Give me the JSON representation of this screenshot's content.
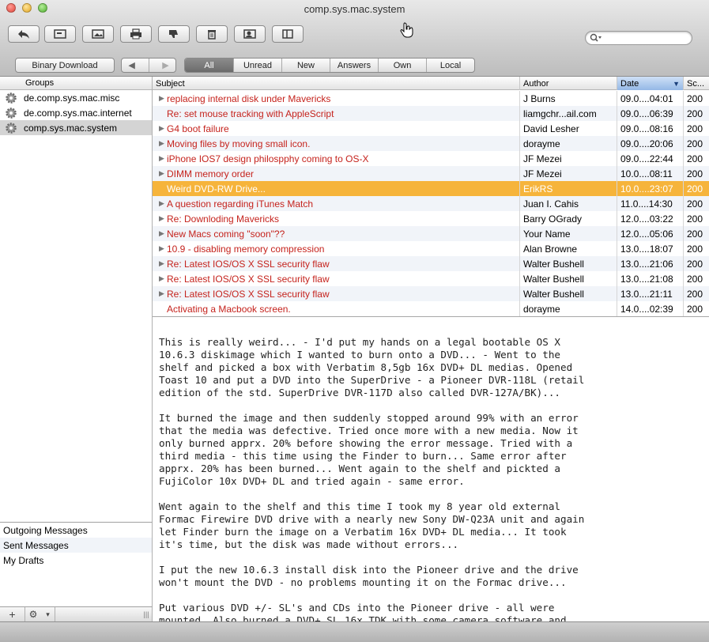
{
  "window": {
    "title": "comp.sys.mac.system"
  },
  "toolbar": {
    "buttons": [
      {
        "name": "reply-icon"
      },
      {
        "name": "compose-icon"
      },
      {
        "name": "image-icon"
      },
      {
        "name": "print-icon"
      },
      {
        "name": "thumbs-down-icon"
      },
      {
        "name": "trash-icon"
      },
      {
        "name": "people-search-icon"
      },
      {
        "name": "panel-icon"
      }
    ],
    "search_placeholder": ""
  },
  "filter_bar": {
    "binary_download": "Binary Download",
    "back": "◀",
    "forward": "▶",
    "tabs": [
      "All",
      "Unread",
      "New",
      "Answers",
      "Own",
      "Local"
    ],
    "active_tab": "All"
  },
  "groups": {
    "header": "Groups",
    "items": [
      {
        "label": "de.comp.sys.mac.misc"
      },
      {
        "label": "de.comp.sys.mac.internet"
      },
      {
        "label": "comp.sys.mac.system",
        "selected": true
      }
    ]
  },
  "mailboxes": {
    "items": [
      "Outgoing Messages",
      "Sent Messages",
      "My Drafts"
    ]
  },
  "left_footer": {
    "add": "+",
    "gear": "⚙",
    "menu": "▾",
    "resize": "|||"
  },
  "list": {
    "columns": {
      "subject": "Subject",
      "author": "Author",
      "date": "Date",
      "sort": "▼",
      "score": "Sc..."
    },
    "rows": [
      {
        "thread": true,
        "subject": "replacing internal disk under Mavericks",
        "author": "J Burns",
        "date": "09.0....04:01",
        "score": "200"
      },
      {
        "thread": false,
        "subject": "Re: set mouse tracking with AppleScript",
        "author": "liamgchr...ail.com",
        "date": "09.0....06:39",
        "score": "200"
      },
      {
        "thread": true,
        "subject": "G4 boot failure",
        "author": "David Lesher",
        "date": "09.0....08:16",
        "score": "200"
      },
      {
        "thread": true,
        "subject": "Moving files by moving small icon.",
        "author": "dorayme",
        "date": "09.0....20:06",
        "score": "200"
      },
      {
        "thread": true,
        "subject": "iPhone IOS7 design philospphy coming to OS-X",
        "author": "JF Mezei",
        "date": "09.0....22:44",
        "score": "200"
      },
      {
        "thread": true,
        "subject": "DIMM memory order",
        "author": "JF Mezei",
        "date": "10.0....08:11",
        "score": "200"
      },
      {
        "thread": false,
        "subject": "Weird DVD-RW Drive...",
        "author": "ErikRS",
        "date": "10.0....23:07",
        "score": "200",
        "selected": true
      },
      {
        "thread": true,
        "subject": "A question regarding iTunes Match",
        "author": "Juan I. Cahis",
        "date": "11.0....14:30",
        "score": "200"
      },
      {
        "thread": true,
        "subject": "Re: Downloding Mavericks",
        "author": "Barry OGrady",
        "date": "12.0....03:22",
        "score": "200"
      },
      {
        "thread": true,
        "subject": "New Macs coming \"soon\"??",
        "author": "Your Name",
        "date": "12.0....05:06",
        "score": "200"
      },
      {
        "thread": true,
        "subject": "10.9 - disabling memory compression",
        "author": "Alan Browne",
        "date": "13.0....18:07",
        "score": "200"
      },
      {
        "thread": true,
        "subject": "Re: Latest IOS/OS X SSL security flaw",
        "author": "Walter Bushell",
        "date": "13.0....21:06",
        "score": "200"
      },
      {
        "thread": true,
        "subject": "Re: Latest IOS/OS X SSL security flaw",
        "author": "Walter Bushell",
        "date": "13.0....21:08",
        "score": "200"
      },
      {
        "thread": true,
        "subject": "Re: Latest IOS/OS X SSL security flaw",
        "author": "Walter Bushell",
        "date": "13.0....21:11",
        "score": "200"
      },
      {
        "thread": false,
        "subject": "Activating a Macbook screen.",
        "author": "dorayme",
        "date": "14.0....02:39",
        "score": "200"
      }
    ]
  },
  "preview": {
    "paragraphs": [
      "This is really weird... - I'd put my hands on a legal bootable OS X\n10.6.3 diskimage which I wanted to burn onto a DVD... - Went to the\nshelf and picked a box with Verbatim 8,5gb 16x DVD+ DL medias. Opened\nToast 10 and put a DVD into the SuperDrive - a Pioneer DVR-118L (retail\nedition of the std. SuperDrive DVR-117D also called DVR-127A/BK)...",
      "It burned the image and then suddenly stopped around 99% with an error\nthat the media was defective. Tried once more with a new media. Now it\nonly burned apprx. 20% before showing the error message. Tried with a\nthird media - this time using the Finder to burn... Same error after\napprx. 20% has been burned... Went again to the shelf and pickted a\nFujiColor 10x DVD+ DL and tried again - same error.",
      "Went again to the shelf and this time I took my 8 year old external\nFormac Firewire DVD drive with a nearly new Sony DW-Q23A unit and again\nlet Finder burn the image on a Verbatim 16x DVD+ DL media... It took\nit's time, but the disk was made without errors...",
      "I put the new 10.6.3 install disk into the Pioneer drive and the drive\nwon't mount the DVD - no problems mounting it on the Formac drive...",
      "Put various DVD +/- SL's and CDs into the Pioneer drive - all were\nmounted. Also burned a DVD+ SL 16x TDK with some camera software and"
    ]
  }
}
